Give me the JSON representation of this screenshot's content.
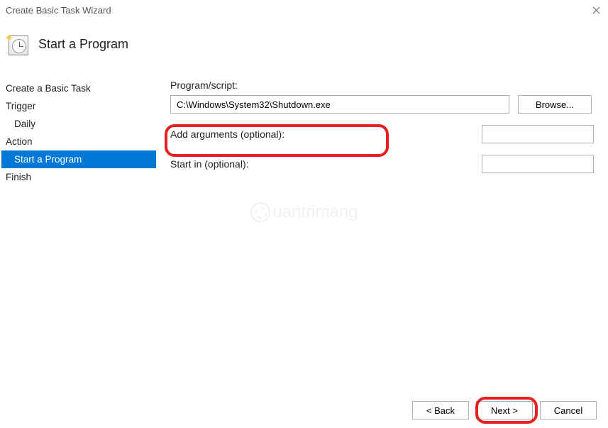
{
  "window": {
    "title": "Create Basic Task Wizard"
  },
  "header": {
    "title": "Start a Program"
  },
  "sidebar": {
    "items": [
      {
        "label": "Create a Basic Task",
        "indent": false,
        "active": false
      },
      {
        "label": "Trigger",
        "indent": false,
        "active": false
      },
      {
        "label": "Daily",
        "indent": true,
        "active": false
      },
      {
        "label": "Action",
        "indent": false,
        "active": false
      },
      {
        "label": "Start a Program",
        "indent": true,
        "active": true
      },
      {
        "label": "Finish",
        "indent": false,
        "active": false
      }
    ]
  },
  "form": {
    "program_label": "Program/script:",
    "program_value": "C:\\Windows\\System32\\Shutdown.exe",
    "browse_label": "Browse...",
    "arguments_label": "Add arguments (optional):",
    "arguments_value": "",
    "startin_label": "Start in (optional):",
    "startin_value": ""
  },
  "footer": {
    "back_label": "< Back",
    "next_label": "Next >",
    "cancel_label": "Cancel"
  },
  "watermark": {
    "text": "uantrimang"
  }
}
